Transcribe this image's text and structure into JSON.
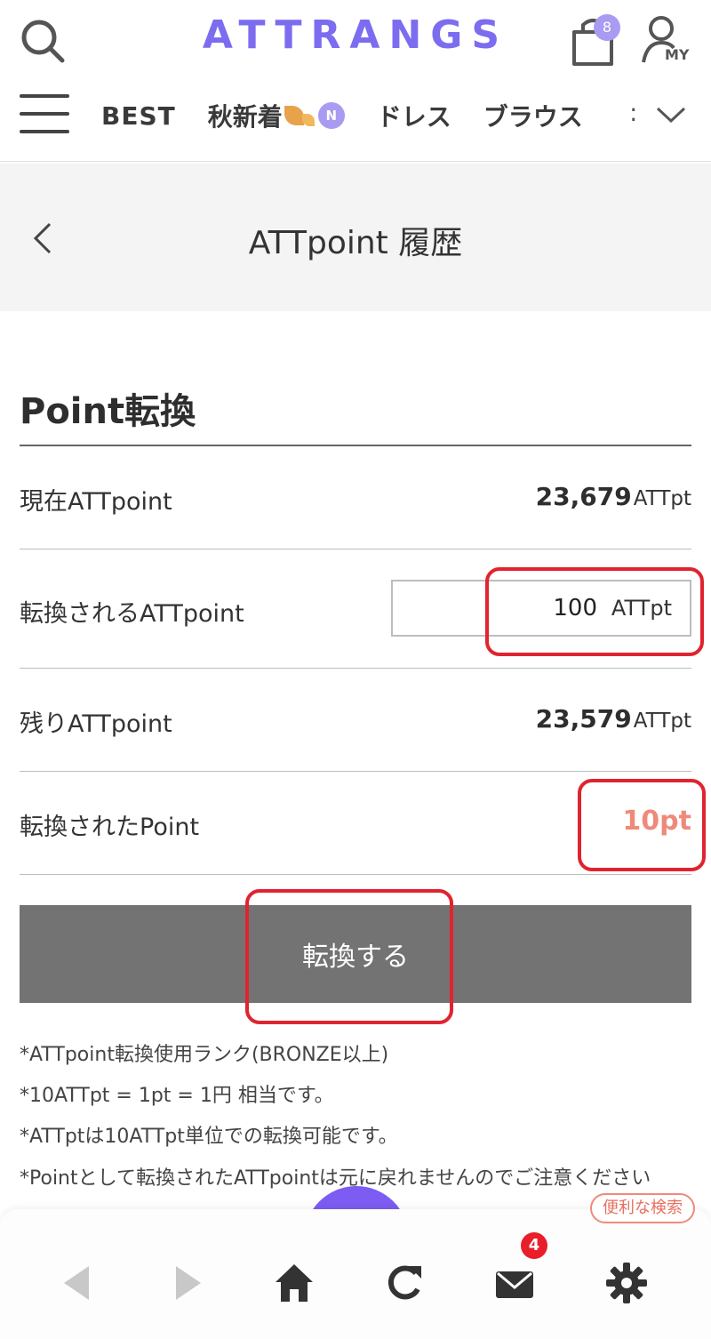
{
  "header": {
    "logo": "ATTRANGS",
    "cart_count": "8",
    "my_label": "MY"
  },
  "nav": {
    "items": [
      "BEST",
      "秋新着",
      "ドレス",
      "ブラウス"
    ],
    "new_badge": "N",
    "overflow_char": ":"
  },
  "page": {
    "title": "ATTpoint 履歴"
  },
  "conversion": {
    "section_title": "Point転換",
    "current_label": "現在ATTpoint",
    "current_value": "23,679",
    "unit": "ATTpt",
    "convert_label": "転換されるATTpoint",
    "convert_input_value": "100",
    "remaining_label": "残りATTpoint",
    "remaining_value": "23,579",
    "converted_label": "転換されたPoint",
    "converted_value": "10pt",
    "submit_label": "転換する"
  },
  "notes": [
    "*ATTpoint転換使用ランク(BRONZE以上)",
    "*10ATTpt = 1pt = 1円 相当です。",
    "*ATTptは10ATTpt単位での転換可能です。",
    "*Pointとして転換されたATTpointは元に戻れませんのでご注意ください"
  ],
  "bottom_bar": {
    "convenient_search": "便利な検索",
    "mail_count": "4"
  },
  "colors": {
    "brand": "#7c6cf0",
    "badge": "#a99bf2",
    "converted_point": "#ef8a7a",
    "highlight": "#e0242f",
    "submit_bg": "#737373",
    "mail_badge": "#e81e2a"
  }
}
